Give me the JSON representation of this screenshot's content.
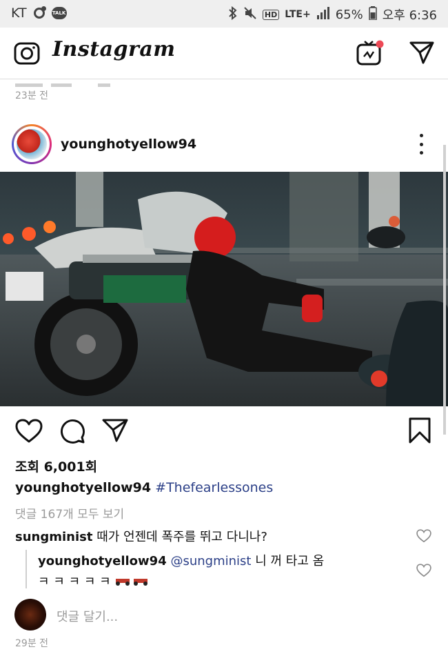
{
  "status_bar": {
    "carrier": "KT",
    "talk_badge": "TALK",
    "hd": "HD",
    "lte": "LTE+",
    "battery": "65%",
    "time": "오후 6:36"
  },
  "app": {
    "title": "Instagram"
  },
  "feed": {
    "previous_timestamp": "23분 전"
  },
  "post": {
    "username": "younghotyellow94",
    "views": "조회 6,001회",
    "caption_user": "younghotyellow94",
    "caption_hashtag": "#Thefearlessones",
    "view_all_comments": "댓글 167개 모두 보기",
    "comments": [
      {
        "user": "sungminist",
        "text": "때가 언젠데 폭주를 뛰고 다니나?"
      }
    ],
    "reply": {
      "user": "younghotyellow94",
      "mention": "@sungminist",
      "text": "니 꺼 타고 옴",
      "text2": "ㅋ ㅋ ㅋ ㅋ ㅋ"
    },
    "add_comment_placeholder": "댓글 달기...",
    "timestamp": "29분 전"
  },
  "colors": {
    "hashtag": "#2b3f87",
    "notification_dot": "#ed4956",
    "muted": "#9a9a9a"
  },
  "icons": [
    "camera-icon",
    "igtv-icon",
    "direct-icon",
    "more-icon",
    "heart-icon",
    "comment-icon",
    "share-icon",
    "bookmark-icon"
  ]
}
